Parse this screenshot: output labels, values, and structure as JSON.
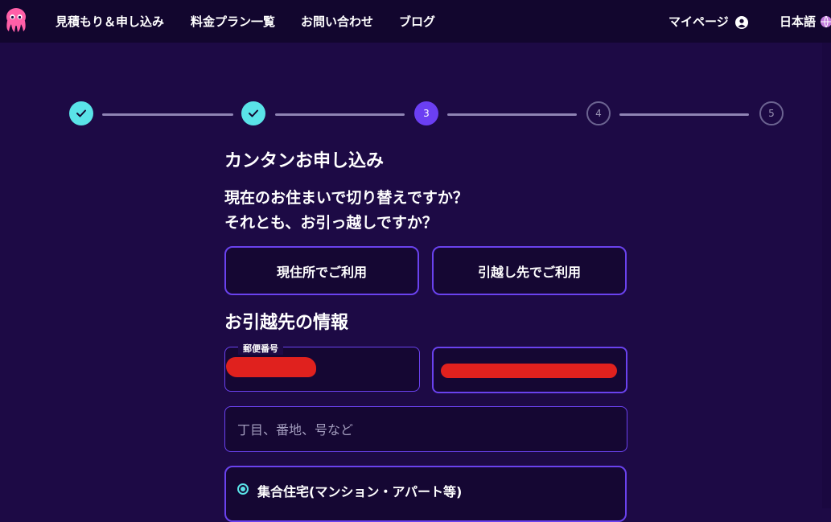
{
  "logo": {
    "icon": "octopus-logo-icon",
    "color": "#ff5fa8"
  },
  "nav": {
    "items": [
      {
        "label": "見積もり＆申し込み"
      },
      {
        "label": "料金プラン一覧"
      },
      {
        "label": "お問い合わせ"
      },
      {
        "label": "ブログ"
      }
    ],
    "mypage": {
      "label": "マイページ",
      "icon": "user-icon"
    },
    "language": {
      "label": "日本語",
      "icon": "globe-icon"
    }
  },
  "stepper": {
    "steps": [
      {
        "label": "",
        "state": "done",
        "icon": "check-icon"
      },
      {
        "label": "",
        "state": "done",
        "icon": "check-icon"
      },
      {
        "label": "3",
        "state": "current"
      },
      {
        "label": "4",
        "state": "pending"
      },
      {
        "label": "5",
        "state": "pending"
      }
    ],
    "colors": {
      "done": "#5ae3e8",
      "current": "#6b3ff2",
      "pending": "#6c6491"
    }
  },
  "form": {
    "title": "カンタンお申し込み",
    "question_line1": "現在のお住まいで切り替えですか？",
    "question_line2": "それとも、お引っ越しですか？",
    "choices": [
      {
        "label": "現住所でご利用"
      },
      {
        "label": "引越し先でご利用"
      }
    ],
    "section_title": "お引越先の情報",
    "postal_code": {
      "label": "郵便番号",
      "value": ""
    },
    "address": {
      "value": ""
    },
    "address_detail": {
      "placeholder": "丁目、番地、号など",
      "value": ""
    },
    "housing_type": {
      "selected_label": "集合住宅(マンション・アパート等)"
    }
  },
  "colors": {
    "background": "#1d0a45",
    "topbar": "#12062e",
    "accent": "#6a42ee",
    "check": "#5ae3e8",
    "redaction": "#e0211e"
  }
}
